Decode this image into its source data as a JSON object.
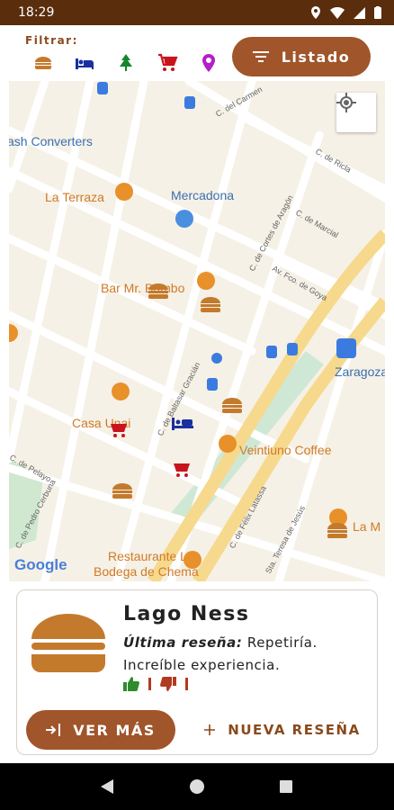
{
  "status": {
    "time": "18:29"
  },
  "header": {
    "filter_label": "Filtrar:",
    "filters": [
      "burger-icon",
      "bed-icon",
      "tree-icon",
      "cart-icon",
      "pin-icon"
    ],
    "listado_label": "Listado"
  },
  "map": {
    "labels": {
      "cash": "ash Converters",
      "terraza": "La Terraza",
      "mercadona": "Mercadona",
      "barmr": "Bar Mr. Bambo",
      "zaragoza": "Zaragoza",
      "casa": "Casa Unai",
      "veintiuno": "Veintiuno Coffee",
      "la_m": "La M",
      "restaurante1": "Restaurante La",
      "restaurante2": "Bodega de Chema",
      "google": "Google",
      "st_carmen": "C. del Carmen",
      "st_ricla": "C. de Ricla",
      "st_cortes": "C. de Cortes de Aragón",
      "st_marcial": "C. de Marcial",
      "st_goya": "Av. Fco. de Goya",
      "st_gracian": "C. de Baltasar Gracián",
      "st_pelayo": "C. de Pelayo",
      "st_cerbuna": "C. de Pedro Cerbuna",
      "st_latassa": "C. de Félix Latassa",
      "st_teresa": "Sta. Teresa de Jesús"
    }
  },
  "card": {
    "title": "Lago Ness",
    "review_label": "Última reseña:",
    "review_text": " Repetiría. Increíble experiencia.",
    "ver_mas": "VER MÁS",
    "nueva_resena": "NUEVA RESEÑA"
  },
  "colors": {
    "brand": "#a0552b",
    "statusbar": "#5a2d0c",
    "accent_text": "#8a4a1c"
  }
}
